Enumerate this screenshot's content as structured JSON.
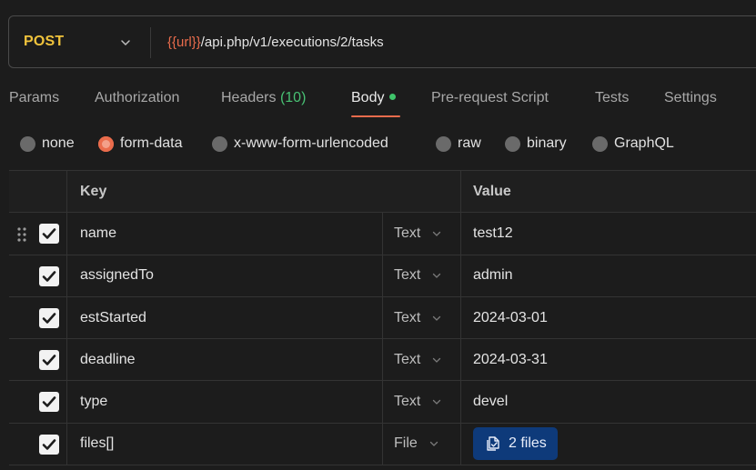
{
  "request": {
    "method": "POST",
    "url_variable": "{{url}}",
    "url_path": "/api.php/v1/executions/2/tasks"
  },
  "tabs": [
    {
      "label": "Params"
    },
    {
      "label": "Authorization"
    },
    {
      "label": "Headers",
      "count": "(10)"
    },
    {
      "label": "Body",
      "active": true
    },
    {
      "label": "Pre-request Script"
    },
    {
      "label": "Tests"
    },
    {
      "label": "Settings"
    }
  ],
  "body_types": [
    {
      "label": "none",
      "selected": false
    },
    {
      "label": "form-data",
      "selected": true
    },
    {
      "label": "x-www-form-urlencoded",
      "selected": false
    },
    {
      "label": "raw",
      "selected": false
    },
    {
      "label": "binary",
      "selected": false
    },
    {
      "label": "GraphQL",
      "selected": false
    }
  ],
  "table": {
    "headers": {
      "key": "Key",
      "value": "Value"
    },
    "rows": [
      {
        "checked": true,
        "key": "name",
        "type": "Text",
        "value": "test12"
      },
      {
        "checked": true,
        "key": "assignedTo",
        "type": "Text",
        "value": "admin"
      },
      {
        "checked": true,
        "key": "estStarted",
        "type": "Text",
        "value": "2024-03-01"
      },
      {
        "checked": true,
        "key": "deadline",
        "type": "Text",
        "value": "2024-03-31"
      },
      {
        "checked": true,
        "key": "type",
        "type": "Text",
        "value": "devel"
      },
      {
        "checked": true,
        "key": "files[]",
        "type": "File",
        "value": "2 files"
      }
    ]
  },
  "colors": {
    "method": "#f0c33c",
    "accent": "#ea6c4c",
    "active_dot": "#3fc46a",
    "files_button": "#0e3a7a"
  }
}
